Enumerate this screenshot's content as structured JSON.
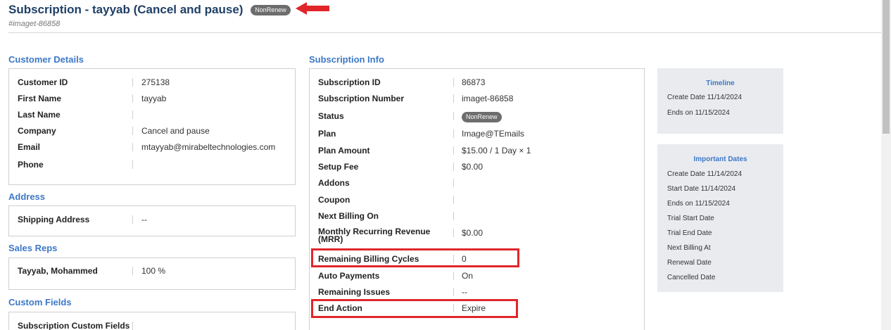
{
  "header": {
    "title": "Subscription - tayyab (Cancel and pause)",
    "status_badge": "NonRenew",
    "subtitle": "#imaget-86858"
  },
  "customer_details": {
    "title": "Customer Details",
    "rows": [
      {
        "label": "Customer ID",
        "value": "275138"
      },
      {
        "label": "First Name",
        "value": "tayyab"
      },
      {
        "label": "Last Name",
        "value": ""
      },
      {
        "label": "Company",
        "value": "Cancel and pause"
      },
      {
        "label": "Email",
        "value": "mtayyab@mirabeltechnologies.com"
      },
      {
        "label": "Phone",
        "value": ""
      }
    ]
  },
  "address": {
    "title": "Address",
    "rows": [
      {
        "label": "Shipping Address",
        "value": "--"
      }
    ]
  },
  "sales_reps": {
    "title": "Sales Reps",
    "rows": [
      {
        "label": "Tayyab, Mohammed",
        "value": "100 %"
      }
    ]
  },
  "custom_fields": {
    "title": "Custom Fields",
    "rows": [
      {
        "label": "Subscription Custom Fields",
        "value": ""
      }
    ]
  },
  "subscription_info": {
    "title": "Subscription Info",
    "rows": [
      {
        "label": "Subscription ID",
        "value": "86873"
      },
      {
        "label": "Subscription Number",
        "value": "imaget-86858"
      },
      {
        "label": "Status",
        "value": "NonRenew"
      },
      {
        "label": "Plan",
        "value": "Image@TEmails"
      },
      {
        "label": "Plan Amount",
        "value": "$15.00 / 1 Day × 1"
      },
      {
        "label": "Setup Fee",
        "value": "$0.00"
      },
      {
        "label": "Addons",
        "value": ""
      },
      {
        "label": "Coupon",
        "value": ""
      },
      {
        "label": "Next Billing On",
        "value": ""
      },
      {
        "label": "Monthly Recurring Revenue",
        "label2": "(MRR)",
        "value": "$0.00"
      },
      {
        "label": "Remaining Billing Cycles",
        "value": "0"
      },
      {
        "label": "Auto Payments",
        "value": "On"
      },
      {
        "label": "Remaining Issues",
        "value": "--"
      },
      {
        "label": "End Action",
        "value": "Expire"
      }
    ]
  },
  "timeline": {
    "title": "Timeline",
    "lines": [
      "Create Date 11/14/2024",
      "Ends on 11/15/2024"
    ]
  },
  "important_dates": {
    "title": "Important Dates",
    "lines": [
      "Create Date 11/14/2024",
      "Start Date 11/14/2024",
      "Ends on 11/15/2024",
      "Trial Start Date",
      "Trial End Date",
      "Next Billing At",
      "Renewal Date",
      "Cancelled Date"
    ]
  },
  "colors": {
    "accent": "#3d78c7",
    "title": "#1f3f66",
    "highlight": "#e0262b",
    "badge": "#6d6d6d",
    "sidebox_bg": "#e9ebef"
  }
}
